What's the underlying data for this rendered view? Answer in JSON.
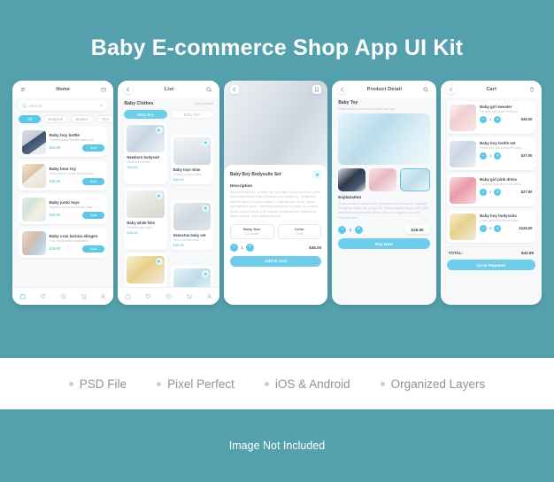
{
  "hero": {
    "title": "Baby E-commerce Shop App UI Kit"
  },
  "colors": {
    "background": "#54a0ad",
    "accent": "#5cc8e8",
    "accent_soft": "#6fcde9",
    "card": "#ffffff",
    "text": "#44494f",
    "muted": "#bcc2ca"
  },
  "screens": {
    "home": {
      "topbar": {
        "title": "Home",
        "left_icon": "menu-icon",
        "right_icon": "calendar-icon"
      },
      "search": {
        "placeholder": "Search",
        "icon": "search-icon",
        "filter_icon": "filter-icon"
      },
      "chips": [
        {
          "label": "All",
          "active": true
        },
        {
          "label": "Bodysuit",
          "active": false
        },
        {
          "label": "Booties",
          "active": false
        },
        {
          "label": "Toys",
          "active": false
        }
      ],
      "products": [
        {
          "name": "Baby boy bottle",
          "desc": "Pellentesque habitia baby boy",
          "price": "$23.00",
          "action": "Add"
        },
        {
          "name": "Baby bear toy",
          "desc": "Senectus et netus et malesua",
          "price": "$40.00",
          "action": "Add"
        },
        {
          "name": "Baby justo toys",
          "desc": "Egestas quis sollicitudin vitae",
          "price": "$35.00",
          "action": "Add"
        },
        {
          "name": "Baby cras lacinia elingen",
          "desc": "Eros consectetur maximus",
          "price": "$19.00",
          "action": "Add"
        }
      ],
      "nav": [
        {
          "icon": "home-icon",
          "active": true
        },
        {
          "icon": "heart-icon",
          "active": false
        },
        {
          "icon": "location-icon",
          "active": false
        },
        {
          "icon": "cart-icon",
          "active": false
        },
        {
          "icon": "person-icon",
          "active": false
        }
      ]
    },
    "list": {
      "topbar": {
        "title": "List",
        "left_icon": "back-icon",
        "right_icon": "search-icon"
      },
      "section": {
        "title": "Baby Clothes",
        "count": "128 product"
      },
      "tabs": [
        {
          "label": "Baby Boy",
          "active": true
        },
        {
          "label": "Baby Girl",
          "active": false
        }
      ],
      "items": [
        {
          "name": "Newborn bodysuit",
          "desc": "Vivamus blandit",
          "price": "$24.00"
        },
        {
          "name": "Baby toys vitae",
          "desc": "Donec conses baby",
          "price": "$30.00"
        },
        {
          "name": "Baby white felis",
          "desc": "Pellentesque arcu",
          "price": "$44.00"
        },
        {
          "name": "Senectus baby set",
          "desc": "Proin lobortis fauci",
          "price": "$26.99"
        }
      ],
      "nav": [
        {
          "icon": "home-icon",
          "active": false
        },
        {
          "icon": "heart-icon",
          "active": false
        },
        {
          "icon": "location-icon",
          "active": false
        },
        {
          "icon": "cart-icon",
          "active": false
        },
        {
          "icon": "person-icon",
          "active": false
        }
      ]
    },
    "detail": {
      "topbar": {
        "left_icon": "back-icon",
        "right_icon": "bookmark-icon"
      },
      "title": "Baby Boy Bodysuits Set",
      "favorite_icon": "heart-icon",
      "description_label": "Description",
      "description": "Curabitur erat odio, porttitor nec nibh eget, lacinia porta elit. Donec lacinia elementum velit, id tristique sem facilisis eu. Vestibulum eleifend ipsum et purus sodales, in aliquam arcu porta. Donec eget eleifend sapien. Maecenas sollicitudin in sapien eu congue. Donec dapibus lacus at leo lobortis, at aliquam orci malesuada. Donec lobortis, risus sagittis condime.",
      "selectors": [
        {
          "label": "Body Size",
          "value": "4-6 month"
        },
        {
          "label": "Color",
          "value": "Grey"
        }
      ],
      "quantity": "1",
      "price": "$45.00",
      "cta": "Add to Cart"
    },
    "product_detail": {
      "topbar": {
        "title": "Product Detail",
        "left_icon": "back-icon",
        "right_icon": "search-icon"
      },
      "title": "Baby Toy",
      "subtitle": "Pellentesque commodo purus est toys",
      "thumbnails": [
        {
          "name": "baby-shoes-thumb",
          "selected": false
        },
        {
          "name": "pink-booties-thumb",
          "selected": false
        },
        {
          "name": "blue-toy-thumb",
          "selected": true
        }
      ],
      "explanation_label": "Explanation",
      "explanation": "Vivamus blandit cursus nulla, et semper eros viverra ut. Quisque ac egestas nulla, nec congue ex. Etiam suscipit semper velit, eget elementum erat lobortis ultrices. Nunc non sagittis purus, et vehicula odio.",
      "quantity": "1",
      "price": "$28.90",
      "cta": "Buy Now"
    },
    "cart": {
      "topbar": {
        "title": "Cart",
        "left_icon": "back-icon",
        "right_icon": "trash-icon"
      },
      "items": [
        {
          "name": "Baby girl sweater",
          "desc": "Semper velit quis dui imper",
          "qty": "1",
          "price": "$45.00"
        },
        {
          "name": "Baby boy bottle set",
          "desc": "Fusce nec arcu posuere baby",
          "qty": "1",
          "price": "$37.00"
        },
        {
          "name": "Baby girl pink dress",
          "desc": "Curabitur posuere risus dress",
          "qty": "1",
          "price": "$27.90"
        },
        {
          "name": "Baby boy bodysuits",
          "desc": "Class aptent taciti sociosqu",
          "qty": "2",
          "price": "$129.00"
        }
      ],
      "total_label": "TOTAL:",
      "total_value": "$43.99",
      "cta": "Go to Payment"
    }
  },
  "features": [
    {
      "label": "PSD File"
    },
    {
      "label": "Pixel Perfect"
    },
    {
      "label": "iOS & Android"
    },
    {
      "label": "Organized Layers"
    }
  ],
  "footer": {
    "note": "Image Not Included"
  }
}
